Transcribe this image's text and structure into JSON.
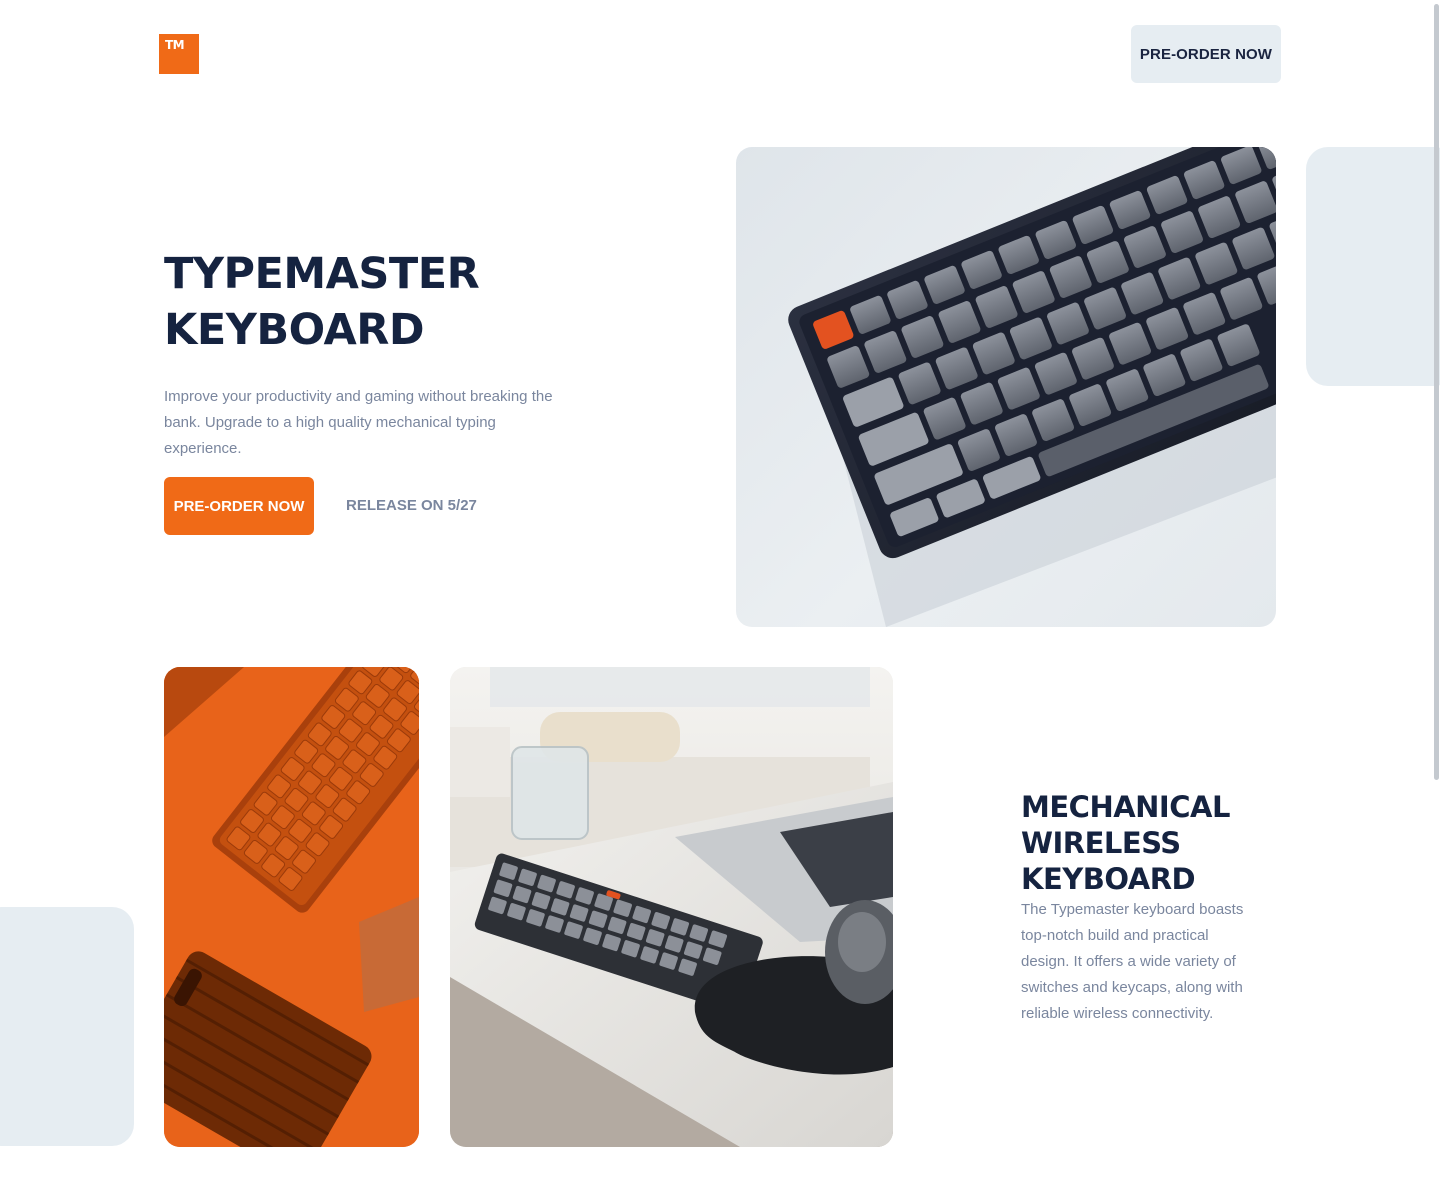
{
  "header": {
    "logo_text": "TM",
    "cta_label": "PRE-ORDER NOW"
  },
  "hero": {
    "title_lines": [
      "TYPEMASTER",
      "KEYBOARD"
    ],
    "description": "Improve your productivity and gaming without breaking the bank. Upgrade to a high quality mechanical typing experience.",
    "cta_label": "PRE-ORDER NOW",
    "release_text": "RELEASE ON 5/27"
  },
  "feature": {
    "title_lines": [
      "MECHANICAL",
      "WIRELESS",
      "KEYBOARD"
    ],
    "description": "The Typemaster keyboard boasts top-notch build and practical design. It offers a wide variety of switches and keycaps, along with reliable wireless connectivity."
  },
  "colors": {
    "accent": "#f06a17",
    "navy": "#152340",
    "muted_text": "#7a869e",
    "light_panel": "#e6edf2"
  }
}
